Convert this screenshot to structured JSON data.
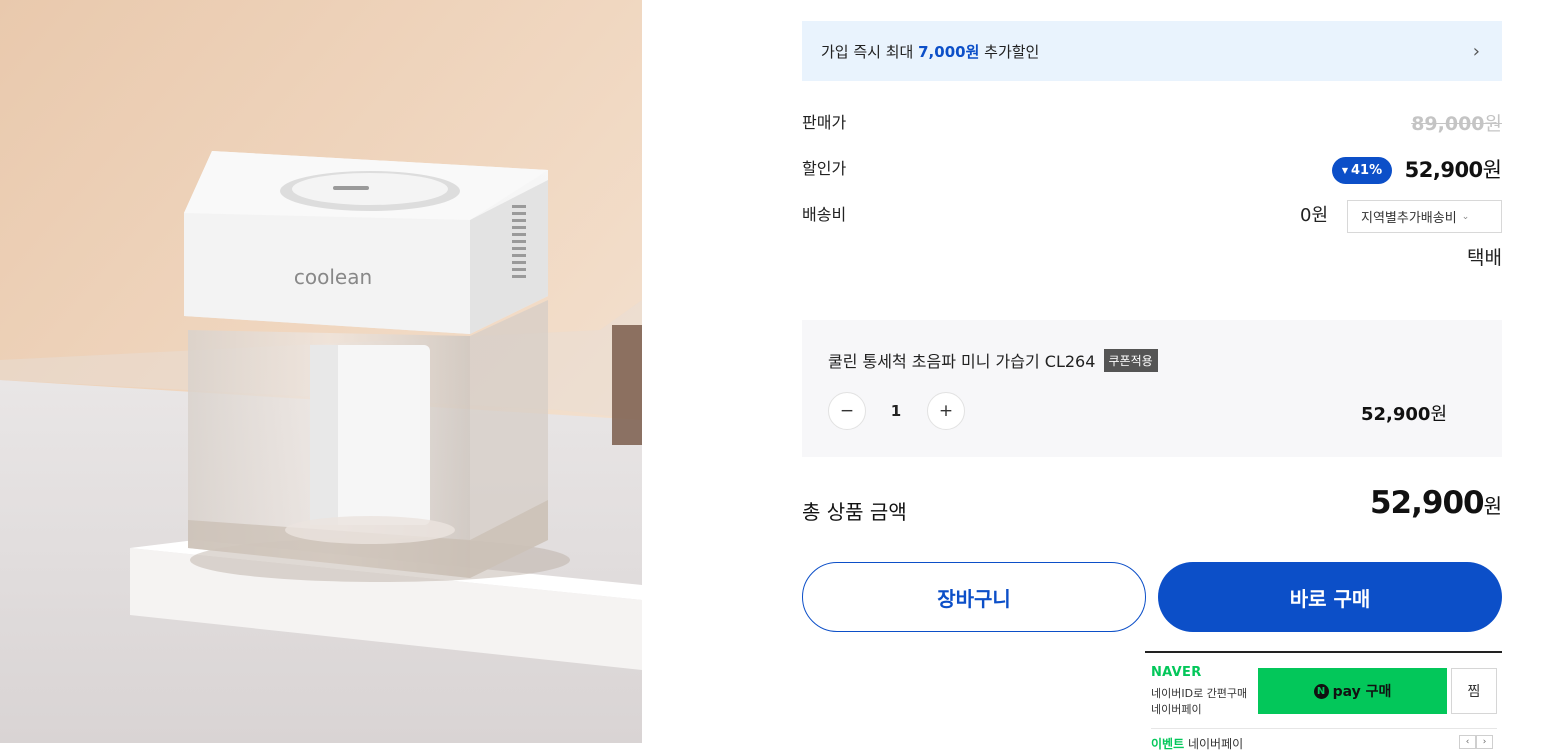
{
  "product_image": {
    "alt": "쿨린 통세척 초음파 미니 가습기",
    "brand_mark": "coolean"
  },
  "promo_banner": {
    "prefix": "가입 즉시 최대",
    "amount": "7,000원",
    "suffix": "추가할인",
    "icon": "chevron-right-icon"
  },
  "pricing": {
    "list_label": "판매가",
    "list_price": "89,000",
    "sale_label": "할인가",
    "discount_rate": "41%",
    "sale_price": "52,900",
    "currency": "원"
  },
  "shipping": {
    "label": "배송비",
    "fee": "0원",
    "region_select": "지역별추가배송비",
    "method": "택배"
  },
  "selected_option": {
    "name": "쿨린 통세척 초음파 미니 가습기 CL264",
    "badge": "쿠폰적용",
    "quantity": "1",
    "minus": "−",
    "plus": "+",
    "price": "52,900",
    "currency": "원"
  },
  "total": {
    "label": "총 상품 금액",
    "amount": "52,900",
    "currency": "원"
  },
  "actions": {
    "cart": "장바구니",
    "buy_now": "바로 구매"
  },
  "naver_pay": {
    "logo": "NAVER",
    "line1": "네이버ID로 간편구매",
    "line2": "네이버페이",
    "button_icon": "N",
    "button_label": "pay 구매",
    "wish": "찜",
    "event_label": "이벤트",
    "event_text": "네이버페이",
    "prev": "‹",
    "next": "›"
  },
  "colors": {
    "accent": "#0c4fc8",
    "banner_bg": "#e9f3fd",
    "naver_green": "#03c75a"
  }
}
